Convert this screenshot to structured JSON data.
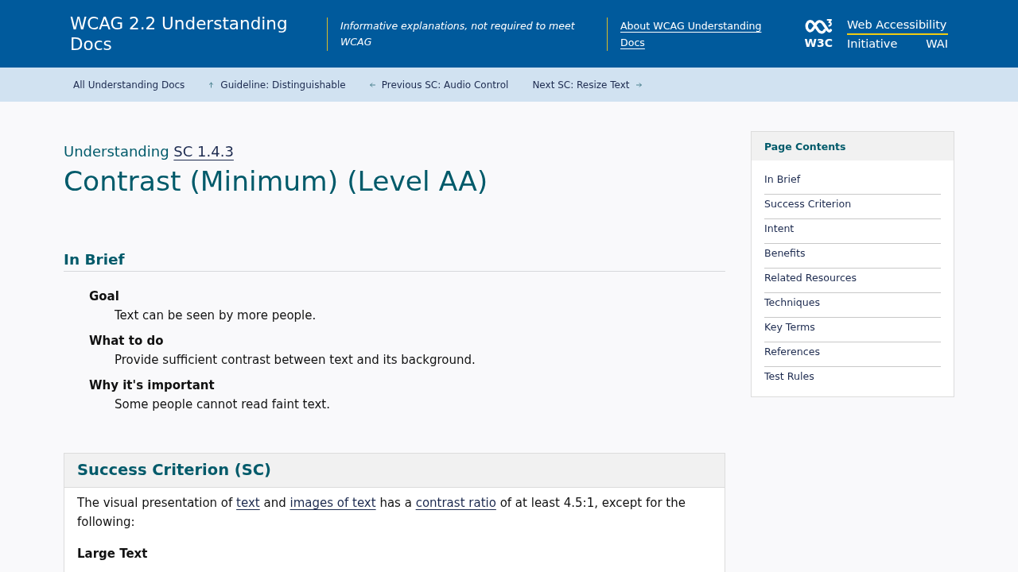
{
  "header": {
    "title": "WCAG 2.2 Understanding Docs",
    "tagline": "Informative explanations, not required to meet WCAG",
    "about_link": "About WCAG Understanding Docs",
    "logo": {
      "mark_label": "W3C",
      "name_top": "Web Accessibility",
      "name_bottom": "Initiative",
      "abbreviation": "WAI"
    }
  },
  "breadcrumb_nav": [
    {
      "label": "All Understanding Docs",
      "kind": "plain"
    },
    {
      "label": "Guideline: Distinguishable",
      "kind": "up"
    },
    {
      "label": "Previous SC: Audio Control",
      "kind": "previous"
    },
    {
      "label": "Next SC: Resize Text",
      "kind": "next"
    }
  ],
  "page": {
    "eyebrow": "Understanding",
    "eyebrow_link": "SC 1.4.3",
    "title": "Contrast (Minimum) (Level AA)"
  },
  "in_brief": {
    "heading": "In Brief",
    "items": [
      {
        "term": "Goal",
        "description": "Text can be seen by more people."
      },
      {
        "term": "What to do",
        "description": "Provide sufficient contrast between text and its background."
      },
      {
        "term": "Why it's important",
        "description": "Some people cannot read faint text."
      }
    ]
  },
  "success_criterion": {
    "heading": "Success Criterion (SC)",
    "paragraph": [
      {
        "kind": "text",
        "text": "The visual presentation of "
      },
      {
        "kind": "link",
        "text": "text"
      },
      {
        "kind": "text",
        "text": " and "
      },
      {
        "kind": "link",
        "text": "images of text"
      },
      {
        "kind": "text",
        "text": " has a "
      },
      {
        "kind": "link",
        "text": "contrast ratio"
      },
      {
        "kind": "text",
        "text": " of at least 4.5:1, except for the following:"
      }
    ],
    "subheading": "Large Text"
  },
  "page_contents": {
    "heading": "Page Contents",
    "items": [
      "In Brief",
      "Success Criterion",
      "Intent",
      "Benefits",
      "Related Resources",
      "Techniques",
      "Key Terms",
      "References",
      "Test Rules"
    ]
  }
}
